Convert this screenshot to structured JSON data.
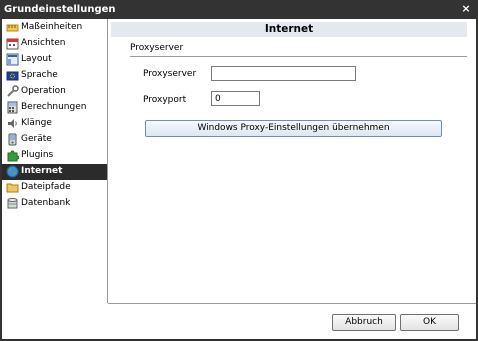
{
  "window": {
    "title": "Grundeinstellungen",
    "close_icon": "×"
  },
  "sidebar": {
    "items": [
      {
        "label": "Maßeinheiten",
        "icon": "ruler-icon"
      },
      {
        "label": "Ansichten",
        "icon": "calendar-icon"
      },
      {
        "label": "Layout",
        "icon": "layout-icon"
      },
      {
        "label": "Sprache",
        "icon": "flag-icon"
      },
      {
        "label": "Operation",
        "icon": "wrench-icon"
      },
      {
        "label": "Berechnungen",
        "icon": "calculator-icon"
      },
      {
        "label": "Klänge",
        "icon": "speaker-icon"
      },
      {
        "label": "Geräte",
        "icon": "device-icon"
      },
      {
        "label": "Plugins",
        "icon": "puzzle-icon"
      },
      {
        "label": "Internet",
        "icon": "globe-icon",
        "selected": true
      },
      {
        "label": "Dateipfade",
        "icon": "folder-icon"
      },
      {
        "label": "Datenbank",
        "icon": "database-icon"
      }
    ]
  },
  "panel": {
    "title": "Internet",
    "section": "Proxyserver",
    "proxyserver_label": "Proxyserver",
    "proxyserver_value": "",
    "proxyport_label": "Proxyport",
    "proxyport_value": "0",
    "proxy_button": "Windows Proxy-Einstellungen übernehmen"
  },
  "footer": {
    "cancel_label": "Abbruch",
    "ok_label": "OK"
  },
  "colors": {
    "titlebar": "#333333",
    "selected_item": "#2b2b2b",
    "panel_header": "#e4e9f0"
  }
}
